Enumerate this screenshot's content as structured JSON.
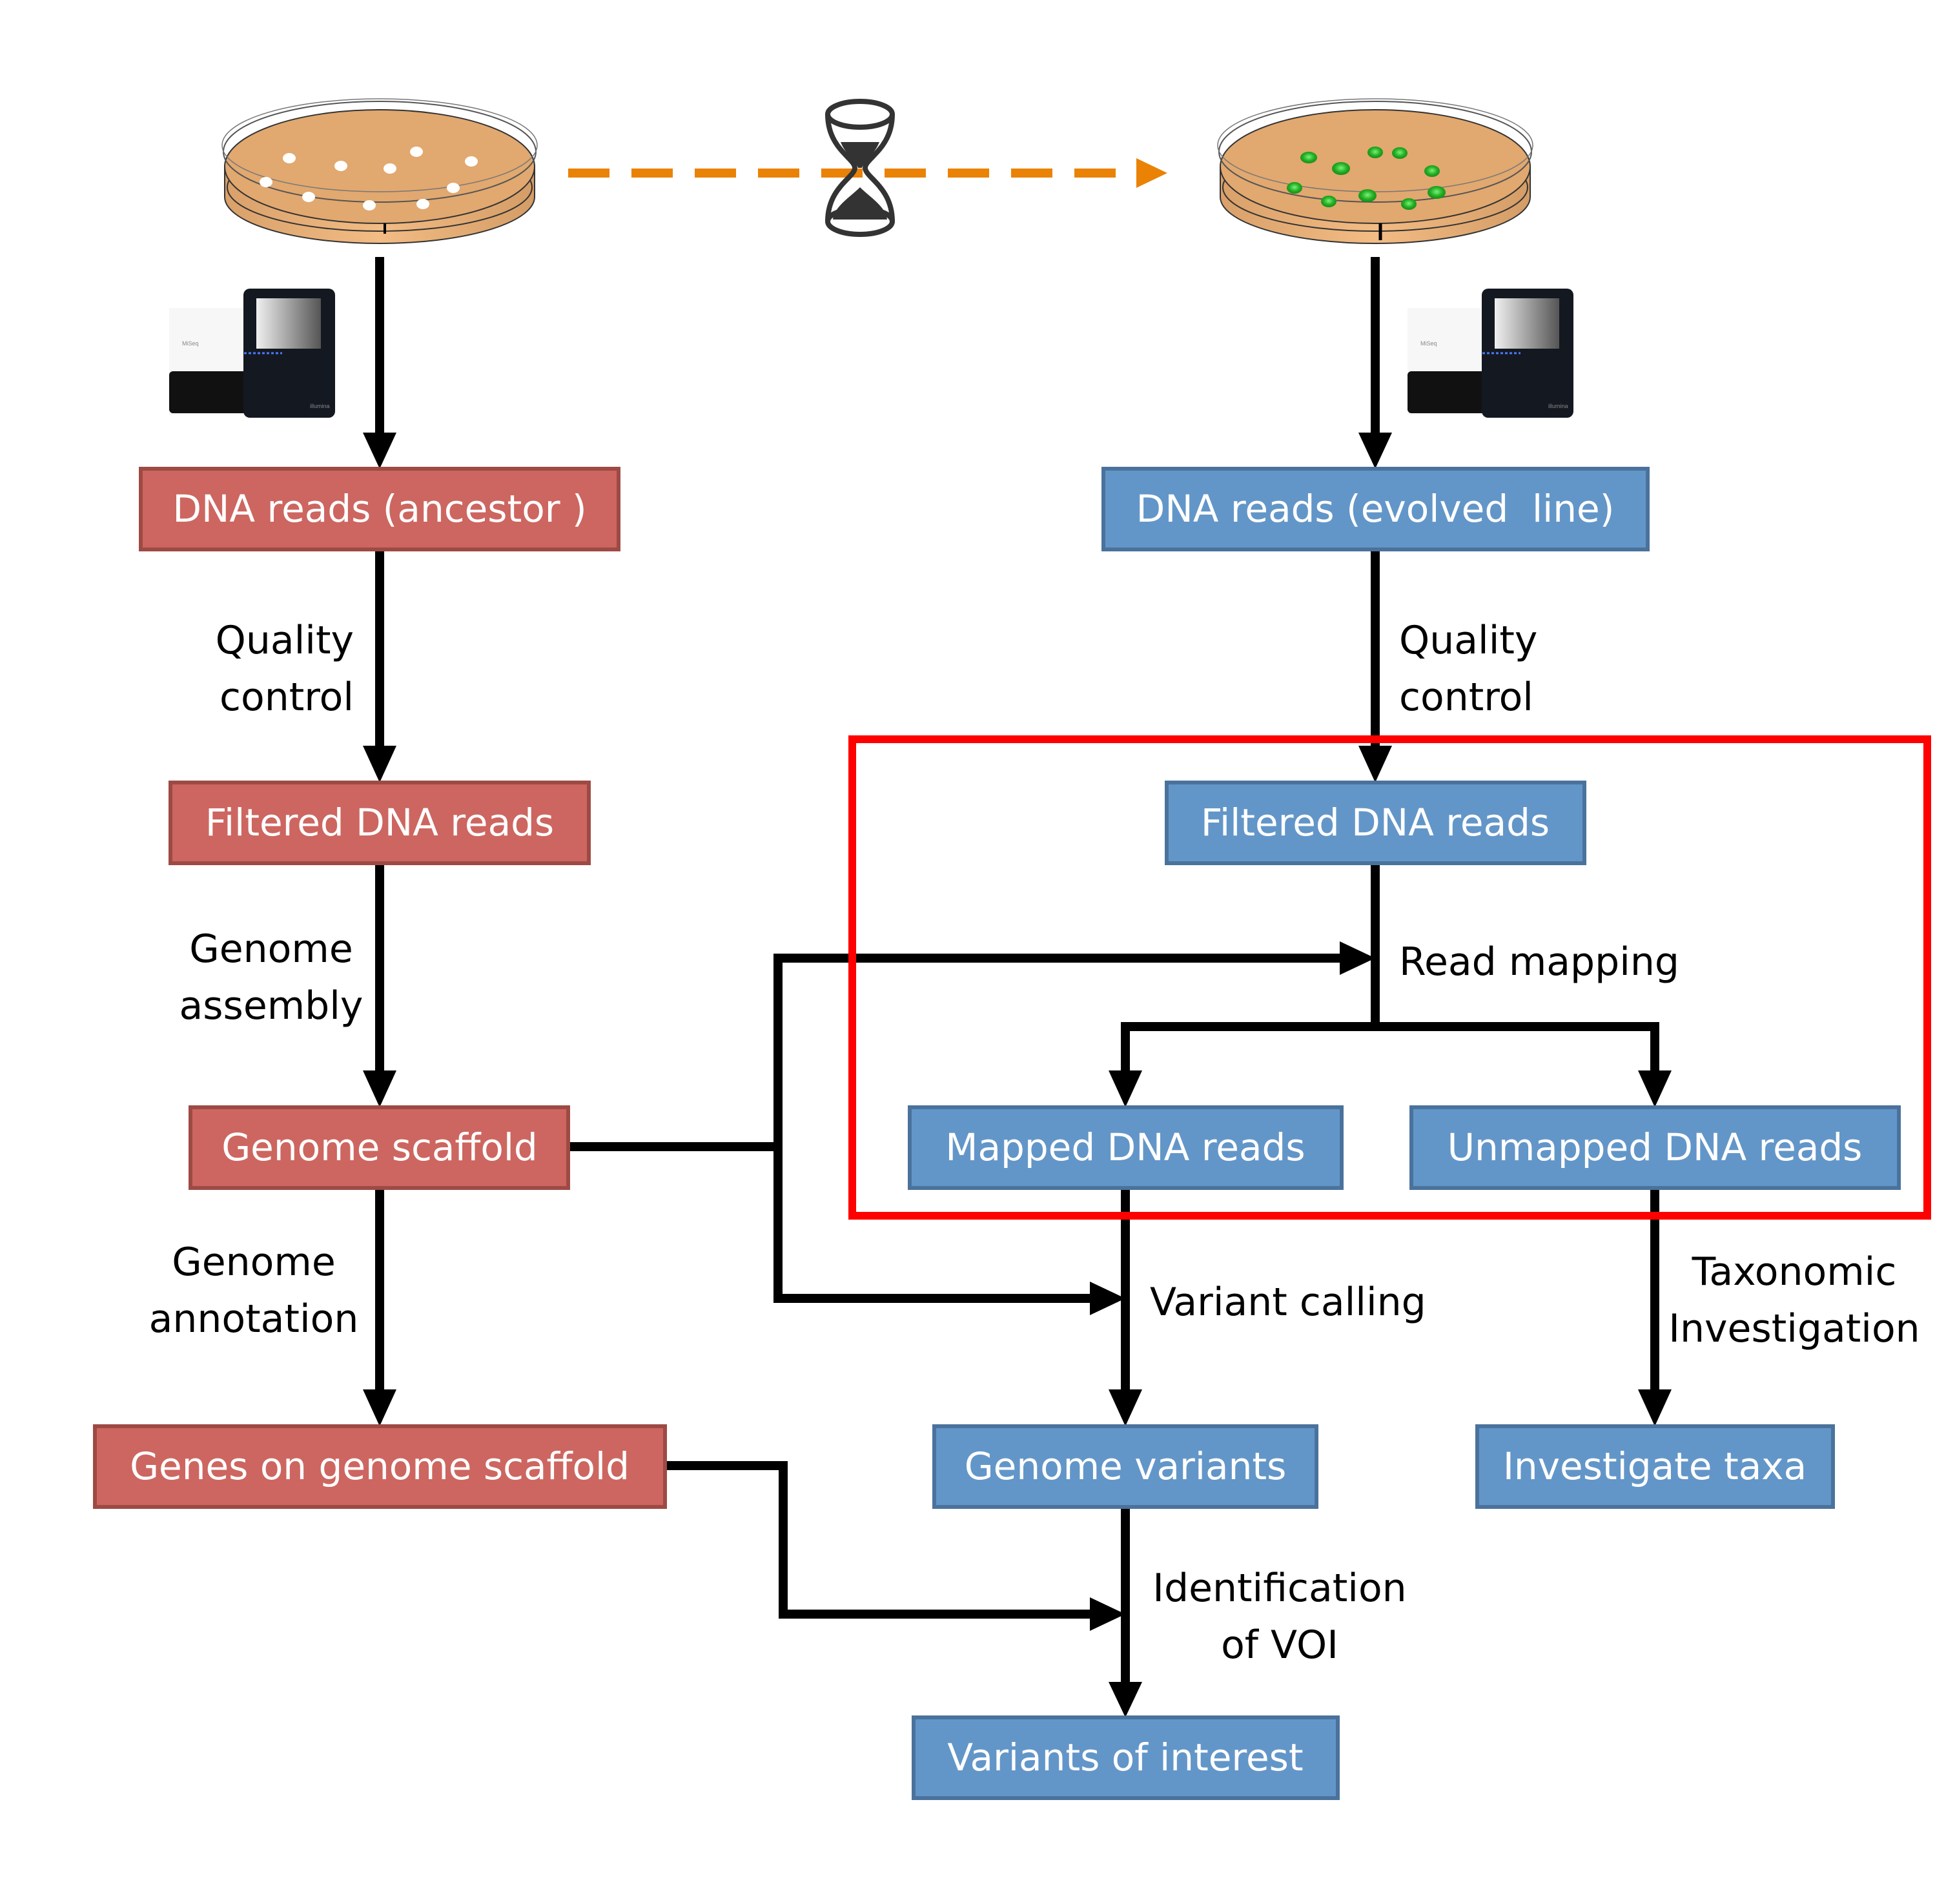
{
  "colors": {
    "ancestor_fill": "#CD6660",
    "ancestor_border": "#9E4A44",
    "evolved_fill": "#6396C8",
    "evolved_border": "#4A729C",
    "highlight": "#FF0000",
    "time_arrow": "#EA8205",
    "agar": "#E1A86F",
    "colony_ancestor": "#FFFFFF",
    "colony_evolved": "#22B022"
  },
  "ancestor": {
    "boxes": {
      "reads": "DNA reads (ancestor )",
      "filtered": "Filtered DNA reads",
      "scaffold": "Genome scaffold",
      "genes": "Genes on genome scaffold"
    },
    "steps": {
      "qc": [
        "Quality",
        "control"
      ],
      "assembly": [
        "Genome",
        "assembly"
      ],
      "annotation": [
        "Genome",
        "annotation"
      ]
    }
  },
  "evolved": {
    "boxes": {
      "reads": "DNA reads (evolved  line)",
      "filtered": "Filtered DNA reads",
      "mapped": "Mapped DNA reads",
      "unmapped": "Unmapped DNA reads",
      "variants": "Genome variants",
      "taxa": "Investigate taxa",
      "voi": "Variants of interest"
    },
    "steps": {
      "qc": [
        "Quality",
        "control"
      ],
      "mapping": "Read mapping",
      "variant_calling": "Variant calling",
      "taxonomic": [
        "Taxonomic",
        "Investigation"
      ],
      "identification": [
        "Identification",
        "of VOI"
      ]
    }
  },
  "sequencer": {
    "model": "MiSeq",
    "brand": "illumina"
  },
  "icons": {
    "petri_dish": "petri-dish-icon",
    "hourglass": "hourglass-icon",
    "sequencer": "sequencer-icon"
  }
}
